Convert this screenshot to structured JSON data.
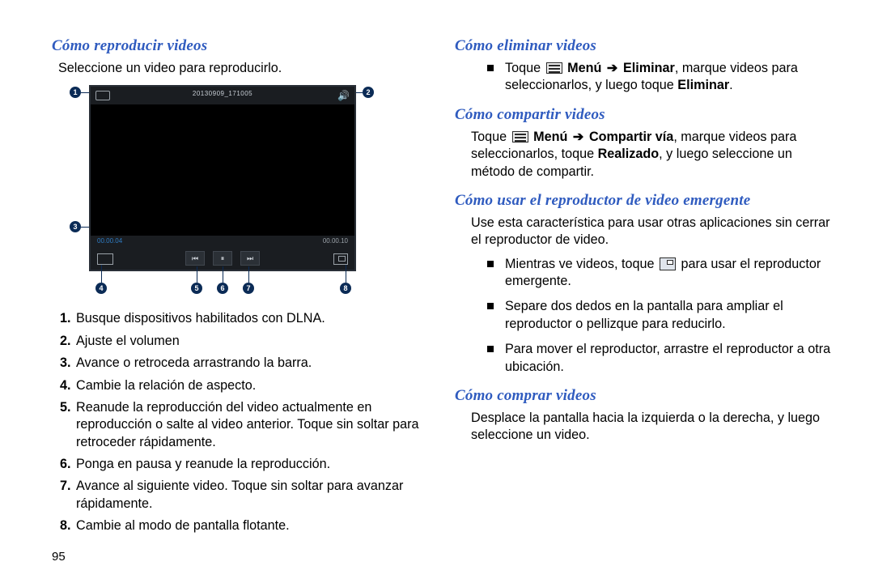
{
  "page_number": "95",
  "left": {
    "h1": "Cómo reproducir videos",
    "intro": "Seleccione un video para reproducirlo.",
    "video": {
      "title": "20130909_171005",
      "time_current": "00.00.04",
      "time_total": "00.00.10"
    },
    "callouts": [
      "1",
      "2",
      "3",
      "4",
      "5",
      "6",
      "7",
      "8"
    ],
    "steps": [
      "Busque dispositivos habilitados con DLNA.",
      "Ajuste el volumen",
      "Avance o retroceda arrastrando la barra.",
      "Cambie la relación de aspecto.",
      "Reanude la reproducción del video actualmente en reproducción o salte al video anterior. Toque sin soltar para retroceder rápidamente.",
      "Ponga en pausa y reanude la reproducción.",
      "Avance al siguiente video. Toque sin soltar para avanzar rápidamente.",
      "Cambie al modo de pantalla flotante."
    ]
  },
  "right": {
    "h1": "Cómo eliminar videos",
    "delete_pre": "Toque ",
    "menu_label": "Menú",
    "arrow": "➔",
    "delete_action": "Eliminar",
    "delete_post": ", marque videos para seleccionarlos, y luego toque ",
    "delete_final": "Eliminar",
    "delete_tail": ".",
    "h2": "Cómo compartir videos",
    "share_pre": "Toque ",
    "share_action": "Compartir vía",
    "share_mid": ", marque videos para seleccionarlos, toque ",
    "share_done": "Realizado",
    "share_post": ", y luego seleccione un método de compartir.",
    "h3": "Cómo usar el reproductor de video emergente",
    "popup_intro": "Use esta característica para usar otras aplicaciones sin cerrar el reproductor de video.",
    "popup_li1_pre": "Mientras ve videos, toque ",
    "popup_li1_post": " para usar el reproductor emergente.",
    "popup_li2": "Separe dos dedos en la pantalla para ampliar el reproductor o pellizque para reducirlo.",
    "popup_li3": "Para mover el reproductor, arrastre el reproductor a otra ubicación.",
    "h4": "Cómo comprar videos",
    "buy_body": "Desplace la pantalla hacia la izquierda o la derecha, y luego seleccione un video."
  }
}
